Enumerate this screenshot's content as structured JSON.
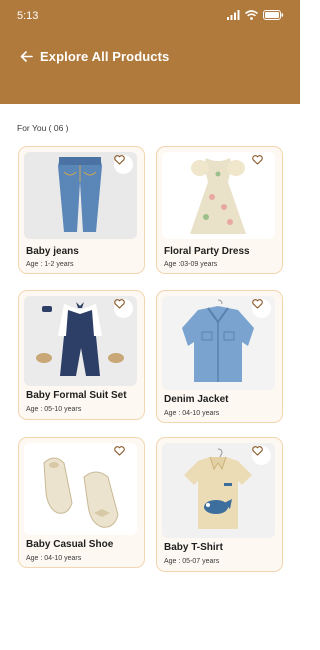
{
  "status": {
    "time": "5:13"
  },
  "header": {
    "title": "Explore All Products"
  },
  "section": {
    "label": "For You ( 06 )"
  },
  "products": [
    {
      "name": "Baby jeans",
      "age": "Age : 1-2 years",
      "icon": "jeans"
    },
    {
      "name": "Floral Party Dress",
      "age": "Age :03-09  years",
      "icon": "dress"
    },
    {
      "name": "Baby Formal Suit Set",
      "age": "Age : 05-10 years",
      "icon": "suit"
    },
    {
      "name": "Denim Jacket",
      "age": "Age : 04-10 years",
      "icon": "jacket"
    },
    {
      "name": "Baby Casual Shoe",
      "age": "Age : 04-10 years",
      "icon": "shoes"
    },
    {
      "name": "Baby T-Shirt",
      "age": "Age : 05-07 years",
      "icon": "tshirt"
    }
  ],
  "colors": {
    "header": "#b07a3c",
    "card_border": "#f2d6b0",
    "card_bg": "#fdf8f1",
    "heart": "#8a5a2b"
  }
}
